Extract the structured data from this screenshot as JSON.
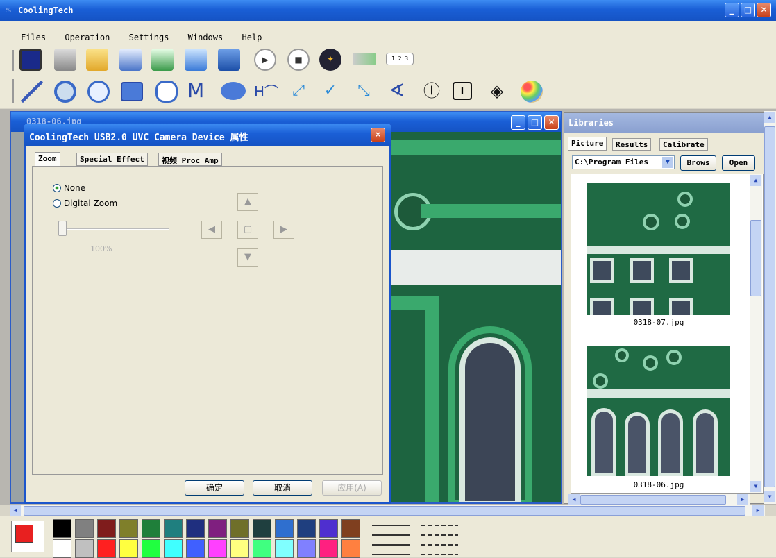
{
  "app": {
    "title": "CoolingTech"
  },
  "menu": [
    "Files",
    "Operation",
    "Settings",
    "Windows",
    "Help"
  ],
  "doc": {
    "title": "0318-06.jpg"
  },
  "dialog": {
    "title": "CoolingTech USB2.0 UVC Camera Device 属性",
    "tabs": [
      "Zoom",
      "Special Effect",
      "视频 Proc Amp"
    ],
    "radio_none": "None",
    "radio_digital": "Digital Zoom",
    "zoom_value": "100%",
    "ok": "确定",
    "cancel": "取消",
    "apply": "应用(A)"
  },
  "libraries": {
    "title": "Libraries",
    "tabs": [
      "Picture",
      "Results",
      "Calibrate"
    ],
    "path": "C:\\Program Files",
    "browse": "Brows",
    "open": "Open",
    "thumbs": [
      "0318-07.jpg",
      "0318-06.jpg"
    ]
  },
  "palette": {
    "top": [
      "#000000",
      "#808080",
      "#7f1c1c",
      "#7f7f2a",
      "#1f7f3a",
      "#1f7f7f",
      "#1f2f7f",
      "#7f1f7f",
      "#6f6f2a",
      "#1f3f3f",
      "#2f6fcf",
      "#1f3f7f",
      "#4f2fcf",
      "#7f3f1f"
    ],
    "bottom": [
      "#ffffff",
      "#c0c0c0",
      "#ff2020",
      "#ffff40",
      "#20ff40",
      "#40ffff",
      "#4060ff",
      "#ff40ff",
      "#ffff80",
      "#40ff80",
      "#80ffff",
      "#8080ff",
      "#ff2080",
      "#ff8040"
    ],
    "current": "#e82020"
  }
}
